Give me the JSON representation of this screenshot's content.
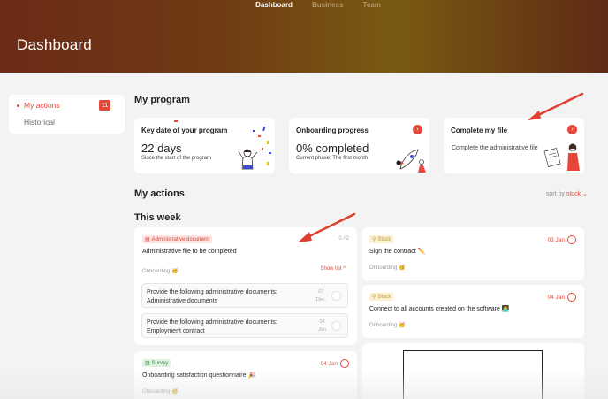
{
  "nav": {
    "items": [
      "Dashboard",
      "Business",
      "Team"
    ]
  },
  "header": {
    "title": "Dashboard"
  },
  "sidebar": {
    "my_actions": "My actions",
    "badge": "11",
    "historical": "Historical"
  },
  "program": {
    "heading": "My program",
    "key_date": {
      "title": "Key date of your program",
      "value": "22 days",
      "caption": "Since the start of the program"
    },
    "progress": {
      "title": "Onboarding progress",
      "value": "0% completed",
      "caption": "Current phase: The first month"
    },
    "file": {
      "title": "Complete my file",
      "desc": "Complete the administrative file"
    }
  },
  "actions": {
    "heading": "My actions",
    "sort_label": "sort by",
    "sort_value": "stock",
    "week_heading": "This week",
    "admin_card": {
      "tag": "Administrative document",
      "counter": "0 / 2",
      "title": "Administrative file to be completed",
      "phase": "Onboarding 🥳",
      "show_list": "Show list",
      "subtasks": [
        {
          "line1": "Provide the following administrative documents:",
          "line2": "Administrative documents",
          "date1": "07",
          "date2": "Dec."
        },
        {
          "line1": "Provide the following administrative documents:",
          "line2": "Employment contract",
          "date1": "04",
          "date2": "Jan"
        }
      ]
    },
    "survey_card": {
      "tag": "Survey",
      "date": "04 Jan",
      "title": "Onboarding satisfaction questionnaire 🎉",
      "phase": "Onboarding 🥳"
    },
    "stock_card_1": {
      "tag": "Stock",
      "date": "03 Jan",
      "title": "Sign the contract ✏️",
      "phase": "Onboarding 🥳"
    },
    "stock_card_2": {
      "tag": "Stock",
      "date": "04 Jan",
      "title": "Connect to all accounts created on the software 🧑‍💻",
      "phase": "Onboarding 🥳"
    }
  },
  "colors": {
    "accent": "#e5483b",
    "hero_start": "#6b2b17",
    "hero_end": "#7a5a12"
  }
}
